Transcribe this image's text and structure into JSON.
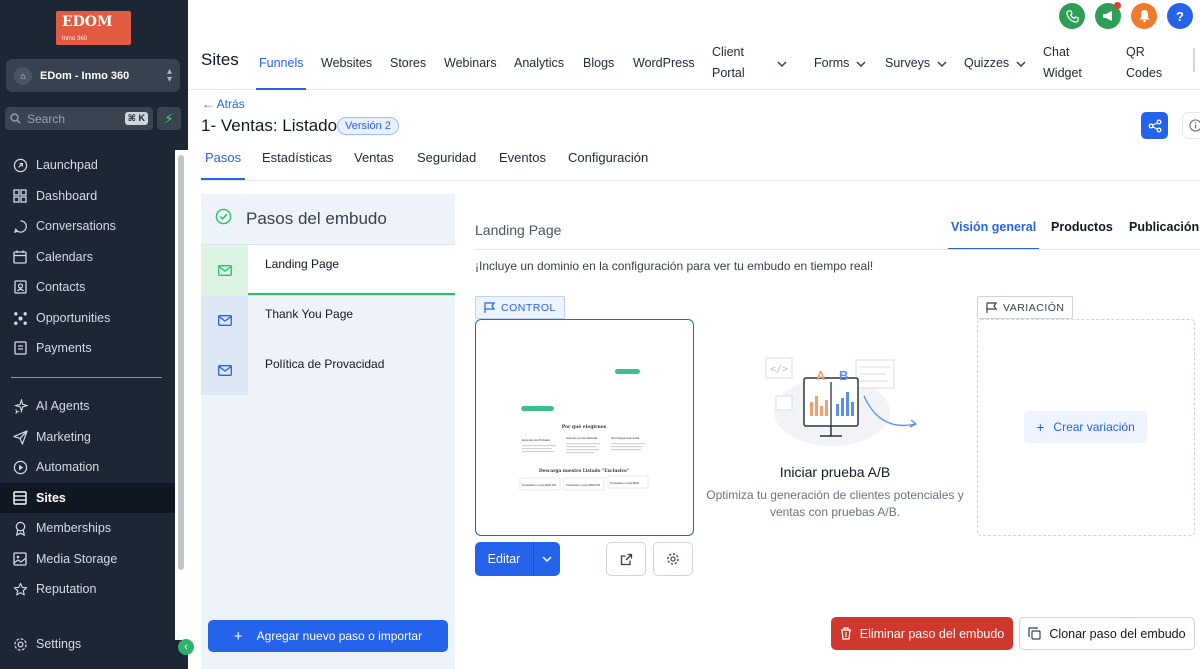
{
  "sidebar": {
    "logo": {
      "main": "EDOM",
      "sub": "Inmo 360"
    },
    "account": "EDom - Inmo 360",
    "search": {
      "placeholder": "Search",
      "shortcut": "⌘ K"
    },
    "items": [
      {
        "label": "Launchpad",
        "icon": "rocket-icon"
      },
      {
        "label": "Dashboard",
        "icon": "dashboard-icon"
      },
      {
        "label": "Conversations",
        "icon": "chat-icon"
      },
      {
        "label": "Calendars",
        "icon": "calendar-icon"
      },
      {
        "label": "Contacts",
        "icon": "contacts-icon"
      },
      {
        "label": "Opportunities",
        "icon": "opportunities-icon"
      },
      {
        "label": "Payments",
        "icon": "payments-icon"
      },
      {
        "label": "AI Agents",
        "icon": "sparkle-icon"
      },
      {
        "label": "Marketing",
        "icon": "send-icon"
      },
      {
        "label": "Automation",
        "icon": "automation-icon"
      },
      {
        "label": "Sites",
        "icon": "sites-icon",
        "active": true
      },
      {
        "label": "Memberships",
        "icon": "memberships-icon"
      },
      {
        "label": "Media Storage",
        "icon": "media-icon"
      },
      {
        "label": "Reputation",
        "icon": "star-icon"
      }
    ],
    "settings": "Settings"
  },
  "topbar": {
    "title": "Sites",
    "nav": [
      {
        "label": "Funnels",
        "active": true
      },
      {
        "label": "Websites"
      },
      {
        "label": "Stores"
      },
      {
        "label": "Webinars"
      },
      {
        "label": "Analytics"
      },
      {
        "label": "Blogs"
      },
      {
        "label": "WordPress"
      },
      {
        "label": "Client Portal",
        "line1": "Client",
        "line2": "Portal",
        "dropdown": true
      },
      {
        "label": "Forms",
        "dropdown": true
      },
      {
        "label": "Surveys",
        "dropdown": true
      },
      {
        "label": "Quizzes",
        "dropdown": true
      },
      {
        "label": "Chat Widget",
        "line1": "Chat",
        "line2": "Widget"
      },
      {
        "label": "QR Codes",
        "line1": "QR",
        "line2": "Codes"
      }
    ],
    "actions": [
      {
        "icon": "phone-icon",
        "color": "#2e9e57"
      },
      {
        "icon": "megaphone-icon",
        "color": "#2e9e57"
      },
      {
        "icon": "bell-icon",
        "color": "#f07a2c"
      },
      {
        "icon": "help-icon",
        "color": "#2563eb",
        "text": "?"
      }
    ]
  },
  "funnel": {
    "back": "Atrás",
    "title": "1- Ventas: Listado",
    "version": "Versión 2",
    "tabs": [
      "Pasos",
      "Estadísticas",
      "Ventas",
      "Seguridad",
      "Eventos",
      "Configuración"
    ]
  },
  "steps": {
    "heading": "Pasos del embudo",
    "items": [
      "Landing Page",
      "Thank You Page",
      "Política de Provacidad"
    ],
    "add_button": "Agregar nuevo paso o importar"
  },
  "detail": {
    "title": "Landing Page",
    "tabs": [
      "Visión general",
      "Productos",
      "Publicación"
    ],
    "notice": "¡Incluye un dominio en la configuración para ver tu embudo en tiempo real!",
    "control_label": "CONTROL",
    "variation_label": "VARIACIÓN",
    "preview": {
      "heading": "Por qué elegirnos",
      "cols": [
        "Experiencia Probada",
        "Atención personalizada",
        "Tecnología avanzada"
      ],
      "cta": "Descarga nuestro Listado \"Exclusivo\"",
      "cards": [
        "Propiedad en venta $000,000",
        "Propiedad en venta $000,000",
        "Propiedad en venta $000"
      ]
    },
    "edit_button": "Editar",
    "ab": {
      "letters": [
        "A",
        "B"
      ],
      "title": "Iniciar prueba A/B",
      "description": "Optimiza tu generación de clientes potenciales y ventas con pruebas A/B."
    },
    "create_variation": "Crear variación",
    "delete_button": "Eliminar paso del embudo",
    "clone_button": "Clonar paso del embudo"
  },
  "colors": {
    "primary": "#2563eb",
    "danger": "#d0372d",
    "success": "#22c55e",
    "sidebar": "#1c2634"
  }
}
